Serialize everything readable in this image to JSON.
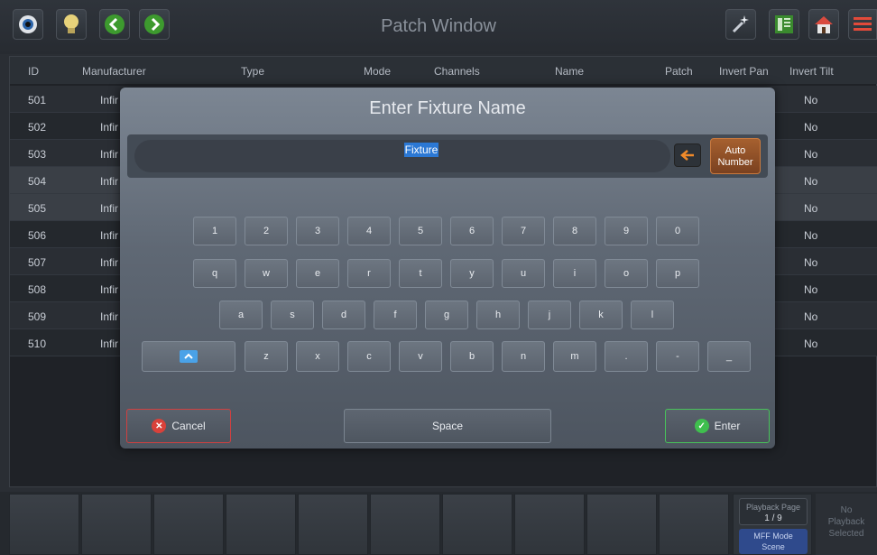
{
  "window": {
    "title": "Patch Window"
  },
  "table": {
    "headers": {
      "id": "ID",
      "manufacturer": "Manufacturer",
      "type": "Type",
      "mode": "Mode",
      "channels": "Channels",
      "name": "Name",
      "patch": "Patch",
      "invert_pan": "Invert Pan",
      "invert_tilt": "Invert Tilt"
    },
    "rows": [
      {
        "id": "501",
        "manufacturer": "Infir",
        "invert_tilt": "No"
      },
      {
        "id": "502",
        "manufacturer": "Infir",
        "invert_tilt": "No"
      },
      {
        "id": "503",
        "manufacturer": "Infir",
        "invert_tilt": "No"
      },
      {
        "id": "504",
        "manufacturer": "Infir",
        "invert_tilt": "No"
      },
      {
        "id": "505",
        "manufacturer": "Infir",
        "invert_tilt": "No"
      },
      {
        "id": "506",
        "manufacturer": "Infir",
        "invert_tilt": "No"
      },
      {
        "id": "507",
        "manufacturer": "Infir",
        "invert_tilt": "No"
      },
      {
        "id": "508",
        "manufacturer": "Infir",
        "invert_tilt": "No"
      },
      {
        "id": "509",
        "manufacturer": "Infir",
        "invert_tilt": "No"
      },
      {
        "id": "510",
        "manufacturer": "Infir",
        "invert_tilt": "No"
      }
    ]
  },
  "dialog": {
    "title": "Enter Fixture Name",
    "input_value": "Fixture",
    "auto_number_line1": "Auto",
    "auto_number_line2": "Number",
    "keys": {
      "row1": [
        "1",
        "2",
        "3",
        "4",
        "5",
        "6",
        "7",
        "8",
        "9",
        "0"
      ],
      "row2": [
        "q",
        "w",
        "e",
        "r",
        "t",
        "y",
        "u",
        "i",
        "o",
        "p"
      ],
      "row3": [
        "a",
        "s",
        "d",
        "f",
        "g",
        "h",
        "j",
        "k",
        "l"
      ],
      "row4": [
        "z",
        "x",
        "c",
        "v",
        "b",
        "n",
        "m",
        ".",
        "-",
        "_"
      ]
    },
    "cancel_label": "Cancel",
    "space_label": "Space",
    "enter_label": "Enter"
  },
  "bottom": {
    "playback_page_label": "Playback Page",
    "playback_page_value": "1 / 9",
    "mff_mode_label": "MFF Mode",
    "mff_mode_value": "Scene",
    "no_playback_line1": "No",
    "no_playback_line2": "Playback",
    "no_playback_line3": "Selected"
  },
  "colors": {
    "accent_blue": "#4aa2e8",
    "cancel_red": "#d04040",
    "enter_green": "#48c25a",
    "auto_number_orange": "#a6602f",
    "nav_green": "#3d9a2e"
  },
  "icons": [
    "eye-icon",
    "lightbulb-icon",
    "back-arrow-icon",
    "forward-arrow-icon",
    "magic-wand-icon",
    "panel-icon",
    "home-icon",
    "menu-icon",
    "backspace-icon",
    "shift-icon",
    "cancel-icon",
    "check-icon"
  ]
}
